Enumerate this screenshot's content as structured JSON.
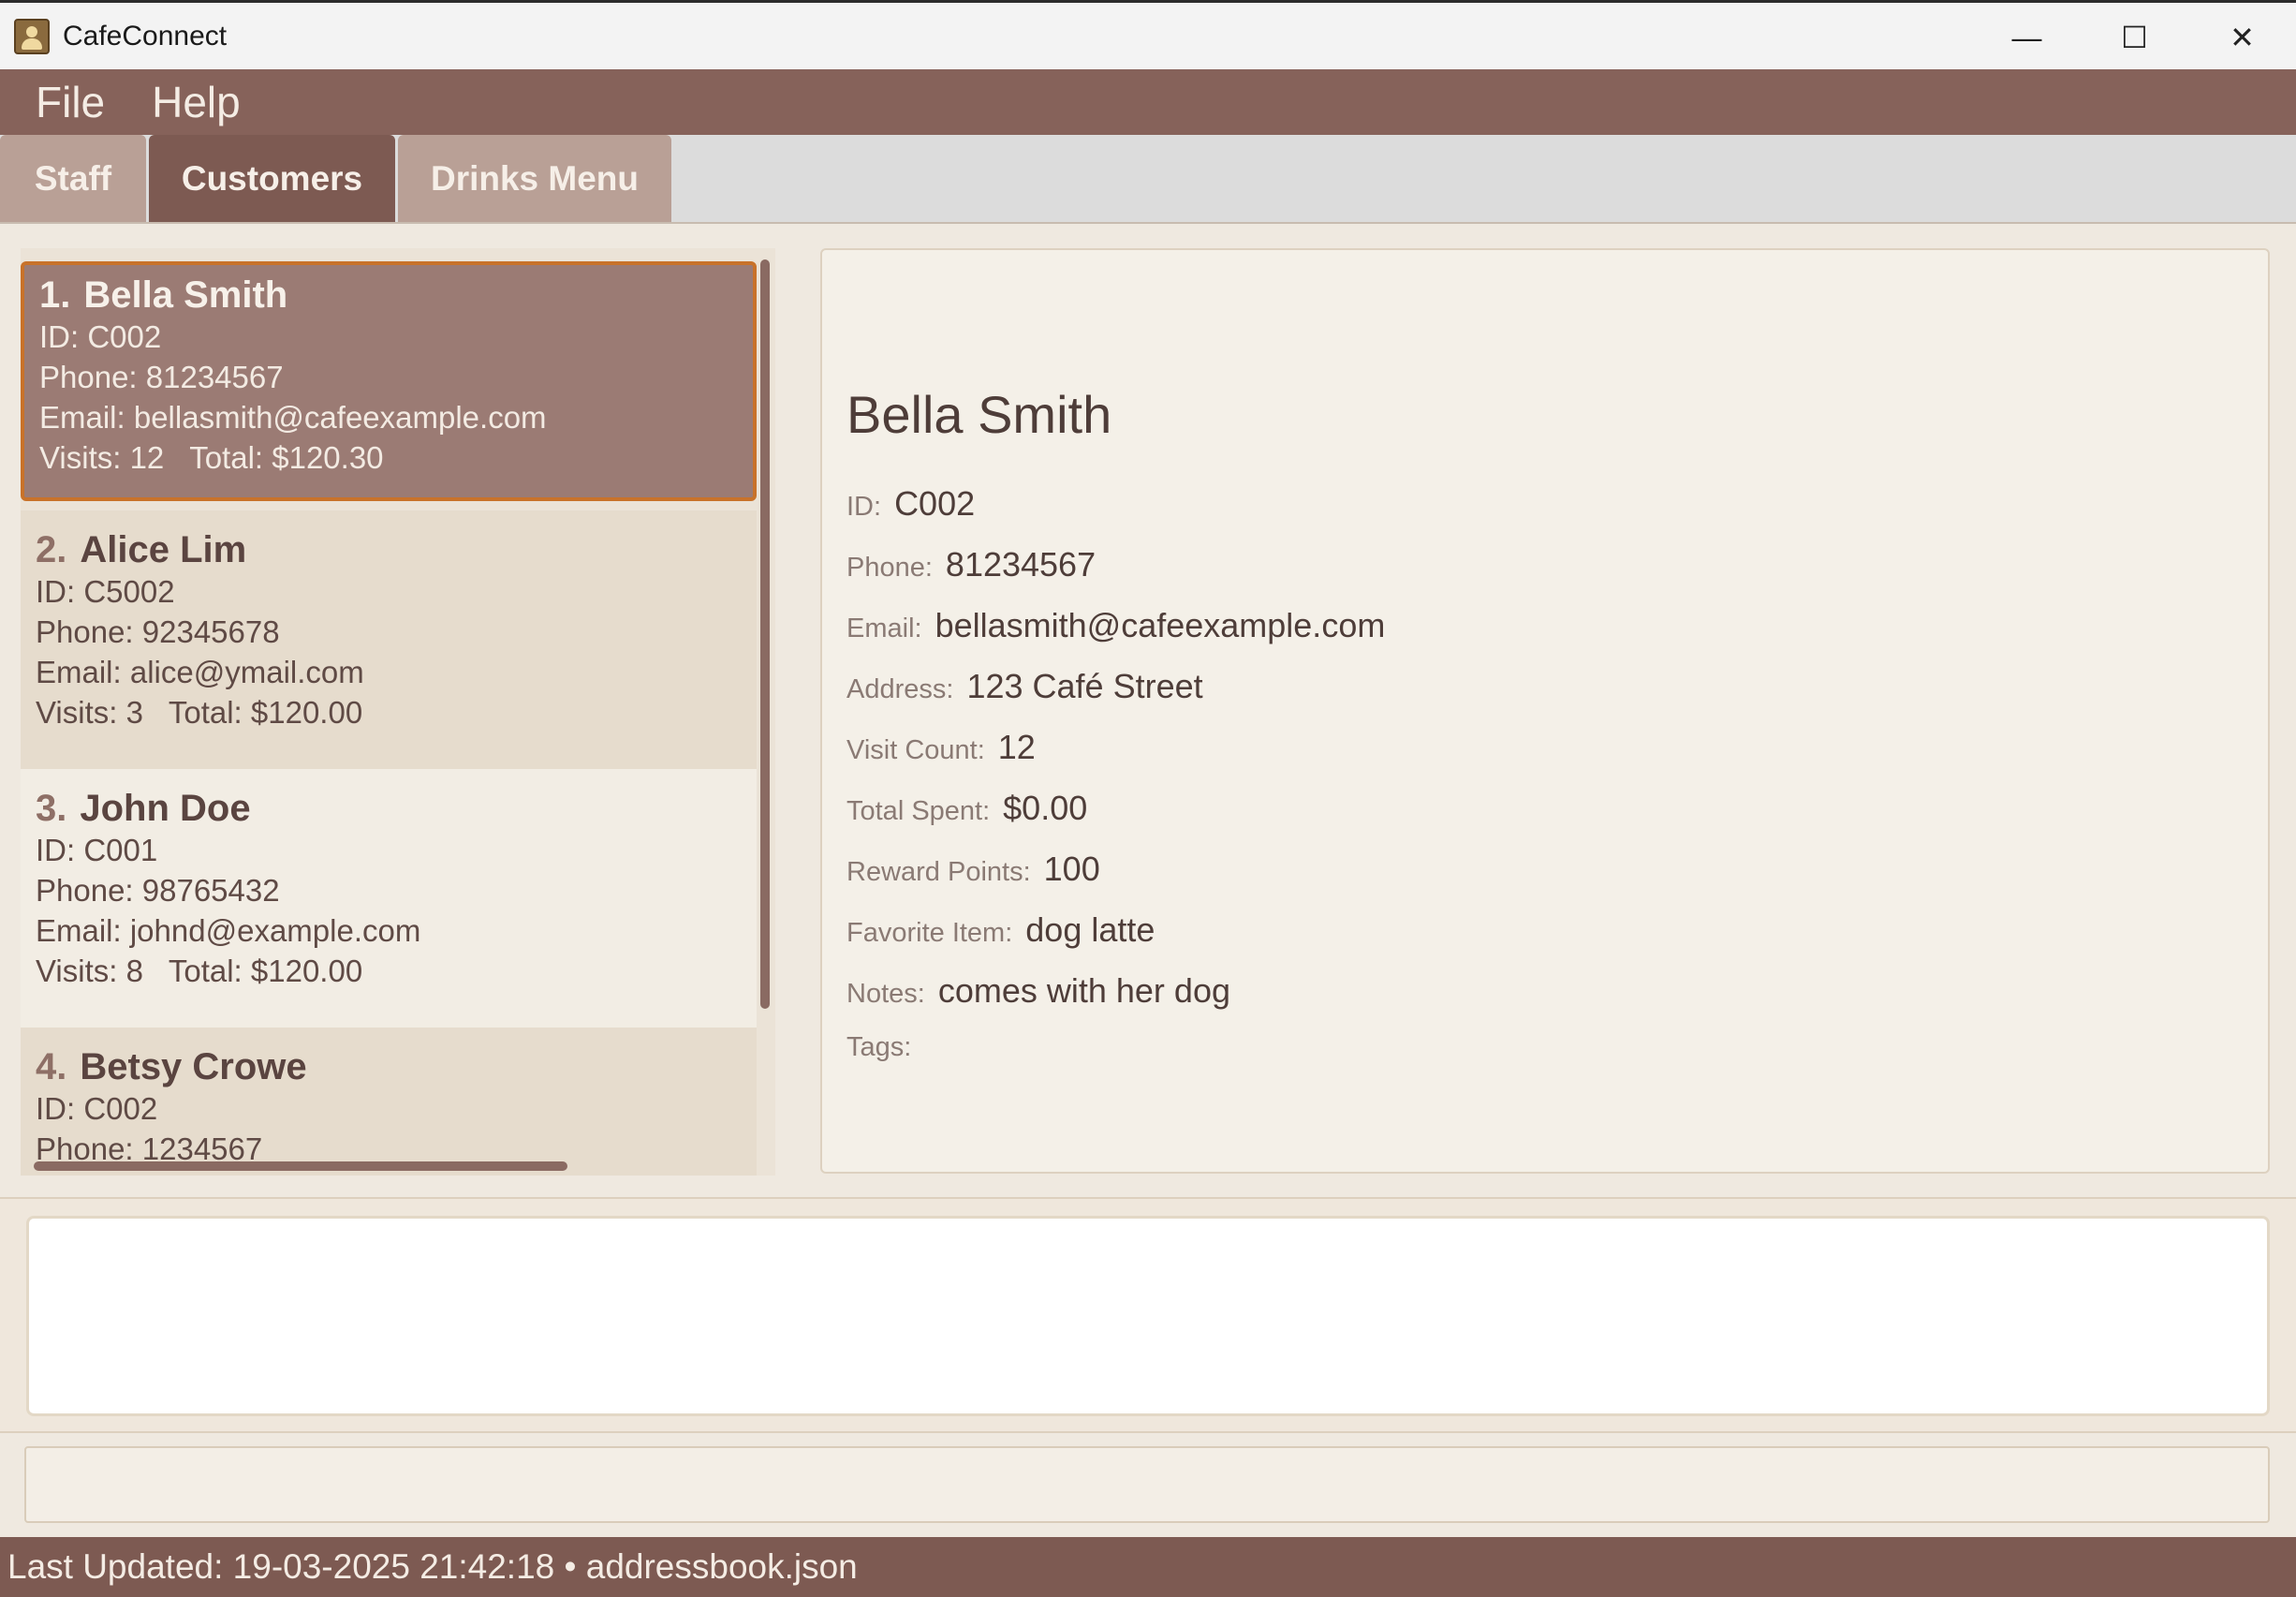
{
  "window": {
    "title": "CafeConnect",
    "minimize_glyph": "—",
    "maximize_glyph": "☐",
    "close_glyph": "✕"
  },
  "menu": [
    "File",
    "Help"
  ],
  "tabs": [
    {
      "label": "Staff",
      "active": false
    },
    {
      "label": "Customers",
      "active": true
    },
    {
      "label": "Drinks Menu",
      "active": false
    }
  ],
  "customers": [
    {
      "index": "1.",
      "name": "Bella Smith",
      "id": "ID: C002",
      "phone": "Phone: 81234567",
      "email": "Email: bellasmith@cafeexample.com",
      "stats": "Visits: 12   Total: $120.30"
    },
    {
      "index": "2.",
      "name": "Alice Lim",
      "id": "ID: C5002",
      "phone": "Phone: 92345678",
      "email": "Email: alice@ymail.com",
      "stats": "Visits: 3   Total: $120.00"
    },
    {
      "index": "3.",
      "name": "John Doe",
      "id": "ID: C001",
      "phone": "Phone: 98765432",
      "email": "Email: johnd@example.com",
      "stats": "Visits: 8   Total: $120.00"
    },
    {
      "index": "4.",
      "name": "Betsy Crowe",
      "id": "ID: C002",
      "phone": "Phone: 1234567",
      "email": "",
      "stats": ""
    }
  ],
  "detail": {
    "name": "Bella Smith",
    "fields": [
      {
        "label": "ID:",
        "value": "C002"
      },
      {
        "label": "Phone:",
        "value": "81234567"
      },
      {
        "label": "Email:",
        "value": "bellasmith@cafeexample.com"
      },
      {
        "label": "Address:",
        "value": "123 Café Street"
      },
      {
        "label": "Visit Count:",
        "value": "12"
      },
      {
        "label": "Total Spent:",
        "value": "$0.00"
      },
      {
        "label": "Reward Points:",
        "value": "100"
      },
      {
        "label": "Favorite Item:",
        "value": "dog latte"
      },
      {
        "label": "Notes:",
        "value": "comes with her dog"
      },
      {
        "label": "Tags:",
        "value": ""
      }
    ]
  },
  "command": {
    "value": ""
  },
  "result": {
    "text": ""
  },
  "status": {
    "text": "Last Updated: 19-03-2025 21:42:18 • addressbook.json"
  }
}
